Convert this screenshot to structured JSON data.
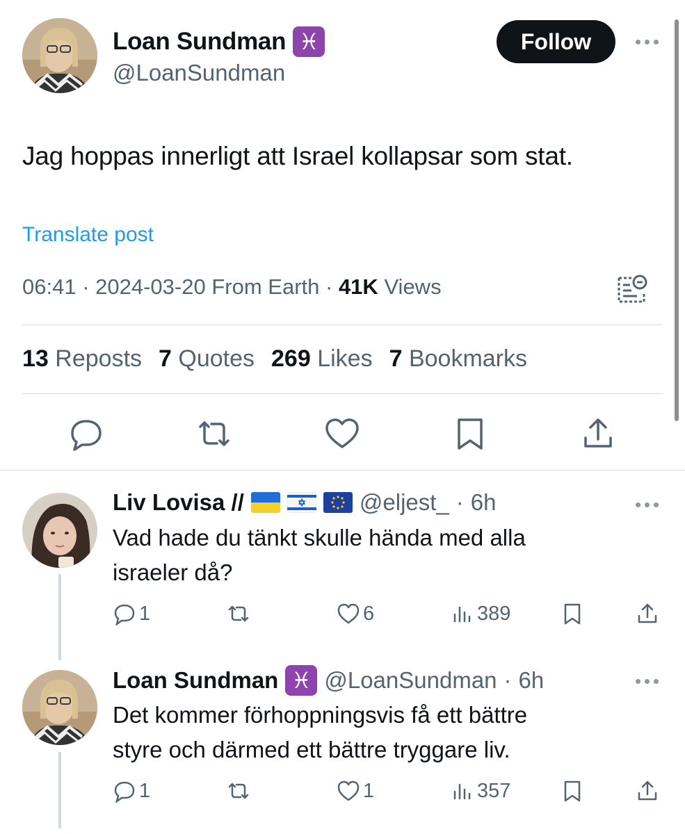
{
  "main_tweet": {
    "author_name": "Loan Sundman",
    "author_badge_glyph": "♓",
    "author_handle": "@LoanSundman",
    "follow_label": "Follow",
    "text": "Jag hoppas innerligt att Israel kollapsar som stat.",
    "translate_label": "Translate post",
    "time": "06:41",
    "date": "2024-03-20",
    "location": "From Earth",
    "views_count": "41K",
    "views_label": "Views",
    "stats": [
      {
        "count": "13",
        "label": "Reposts"
      },
      {
        "count": "7",
        "label": "Quotes"
      },
      {
        "count": "269",
        "label": "Likes"
      },
      {
        "count": "7",
        "label": "Bookmarks"
      }
    ],
    "actions": [
      "reply-icon",
      "repost-icon",
      "like-icon",
      "bookmark-icon",
      "share-icon"
    ]
  },
  "replies": [
    {
      "author_name": "Liv Lovisa //",
      "flags": [
        "ukraine-flag",
        "israel-flag",
        "eu-flag"
      ],
      "author_handle": "@eljest_",
      "time_sep": "·",
      "time": "6h",
      "text_lines": [
        "Vad hade du tänkt skulle hända med alla",
        "israeler då?"
      ],
      "replies_count": "1",
      "reposts_count": "",
      "likes_count": "6",
      "views_count": "389"
    },
    {
      "author_name": "Loan Sundman",
      "author_badge_glyph": "♓",
      "author_handle": "@LoanSundman",
      "time_sep": "·",
      "time": "6h",
      "text_lines": [
        "Det kommer förhoppningsvis få ett bättre",
        "styre och därmed ett bättre tryggare liv."
      ],
      "replies_count": "1",
      "reposts_count": "",
      "likes_count": "1",
      "views_count": "357"
    }
  ],
  "colors": {
    "text": "#0f1419",
    "muted": "#536471",
    "link": "#1d9bf0",
    "divider": "#cfd9de",
    "pisces_badge": "#8e44ad",
    "follow_button": "#0f1419"
  }
}
